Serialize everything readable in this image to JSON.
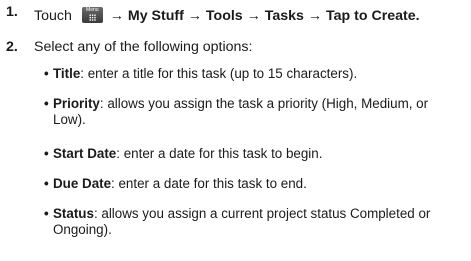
{
  "steps": [
    {
      "number": "1.",
      "prefix": "Touch",
      "menu_key": {
        "label": "Menu",
        "icon": "menu-grid-icon"
      },
      "path": "→ My Stuff → Tools → Tasks → Tap to Create."
    },
    {
      "number": "2.",
      "text": "Select any of the following options:"
    }
  ],
  "options": [
    {
      "term": "Title",
      "description": ": enter a title for this task (up to 15 characters)."
    },
    {
      "term": "Priority",
      "description": ": allows you assign the task a priority (High, Medium, or Low)."
    },
    {
      "term": "Start Date",
      "description": ": enter a date for this task to begin."
    },
    {
      "term": "Due Date",
      "description": ": enter a date for this task to end."
    },
    {
      "term": "Status",
      "description": ": allows you assign a current project status Completed or Ongoing)."
    }
  ],
  "bullet_char": "•"
}
